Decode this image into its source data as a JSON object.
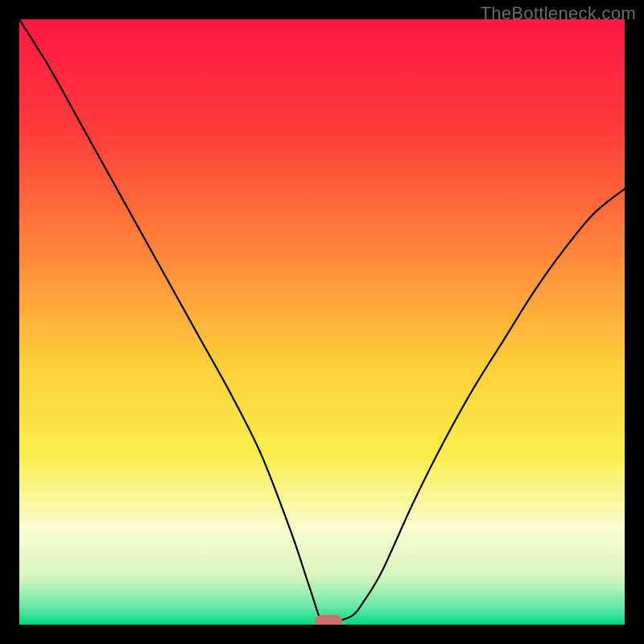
{
  "watermark": "TheBottleneck.com",
  "chart_data": {
    "type": "line",
    "title": "",
    "xlabel": "",
    "ylabel": "",
    "xlim": [
      0,
      100
    ],
    "ylim": [
      0,
      100
    ],
    "grid": false,
    "gradient_stops": [
      {
        "offset": 0,
        "color": "#ff1744"
      },
      {
        "offset": 18,
        "color": "#ff3b3b"
      },
      {
        "offset": 40,
        "color": "#ff8c3a"
      },
      {
        "offset": 58,
        "color": "#ffd23a"
      },
      {
        "offset": 72,
        "color": "#f9ee4a"
      },
      {
        "offset": 84,
        "color": "#fcfccf"
      },
      {
        "offset": 92,
        "color": "#d6f7bd"
      },
      {
        "offset": 97,
        "color": "#6ae8a8"
      },
      {
        "offset": 100,
        "color": "#00d97e"
      }
    ],
    "series": [
      {
        "name": "bottleneck-curve",
        "x": [
          0,
          5,
          10,
          15,
          20,
          25,
          30,
          35,
          40,
          45,
          48,
          50,
          52,
          55,
          57,
          60,
          65,
          70,
          75,
          80,
          85,
          90,
          95,
          100
        ],
        "y": [
          100,
          92,
          83,
          74,
          65,
          56,
          47,
          38,
          28,
          15,
          6,
          0.5,
          0.5,
          1.5,
          4,
          9,
          20,
          30,
          39,
          47,
          55,
          62,
          68,
          72
        ]
      }
    ],
    "minimum_marker": {
      "x": 51,
      "y": 0.5
    }
  }
}
